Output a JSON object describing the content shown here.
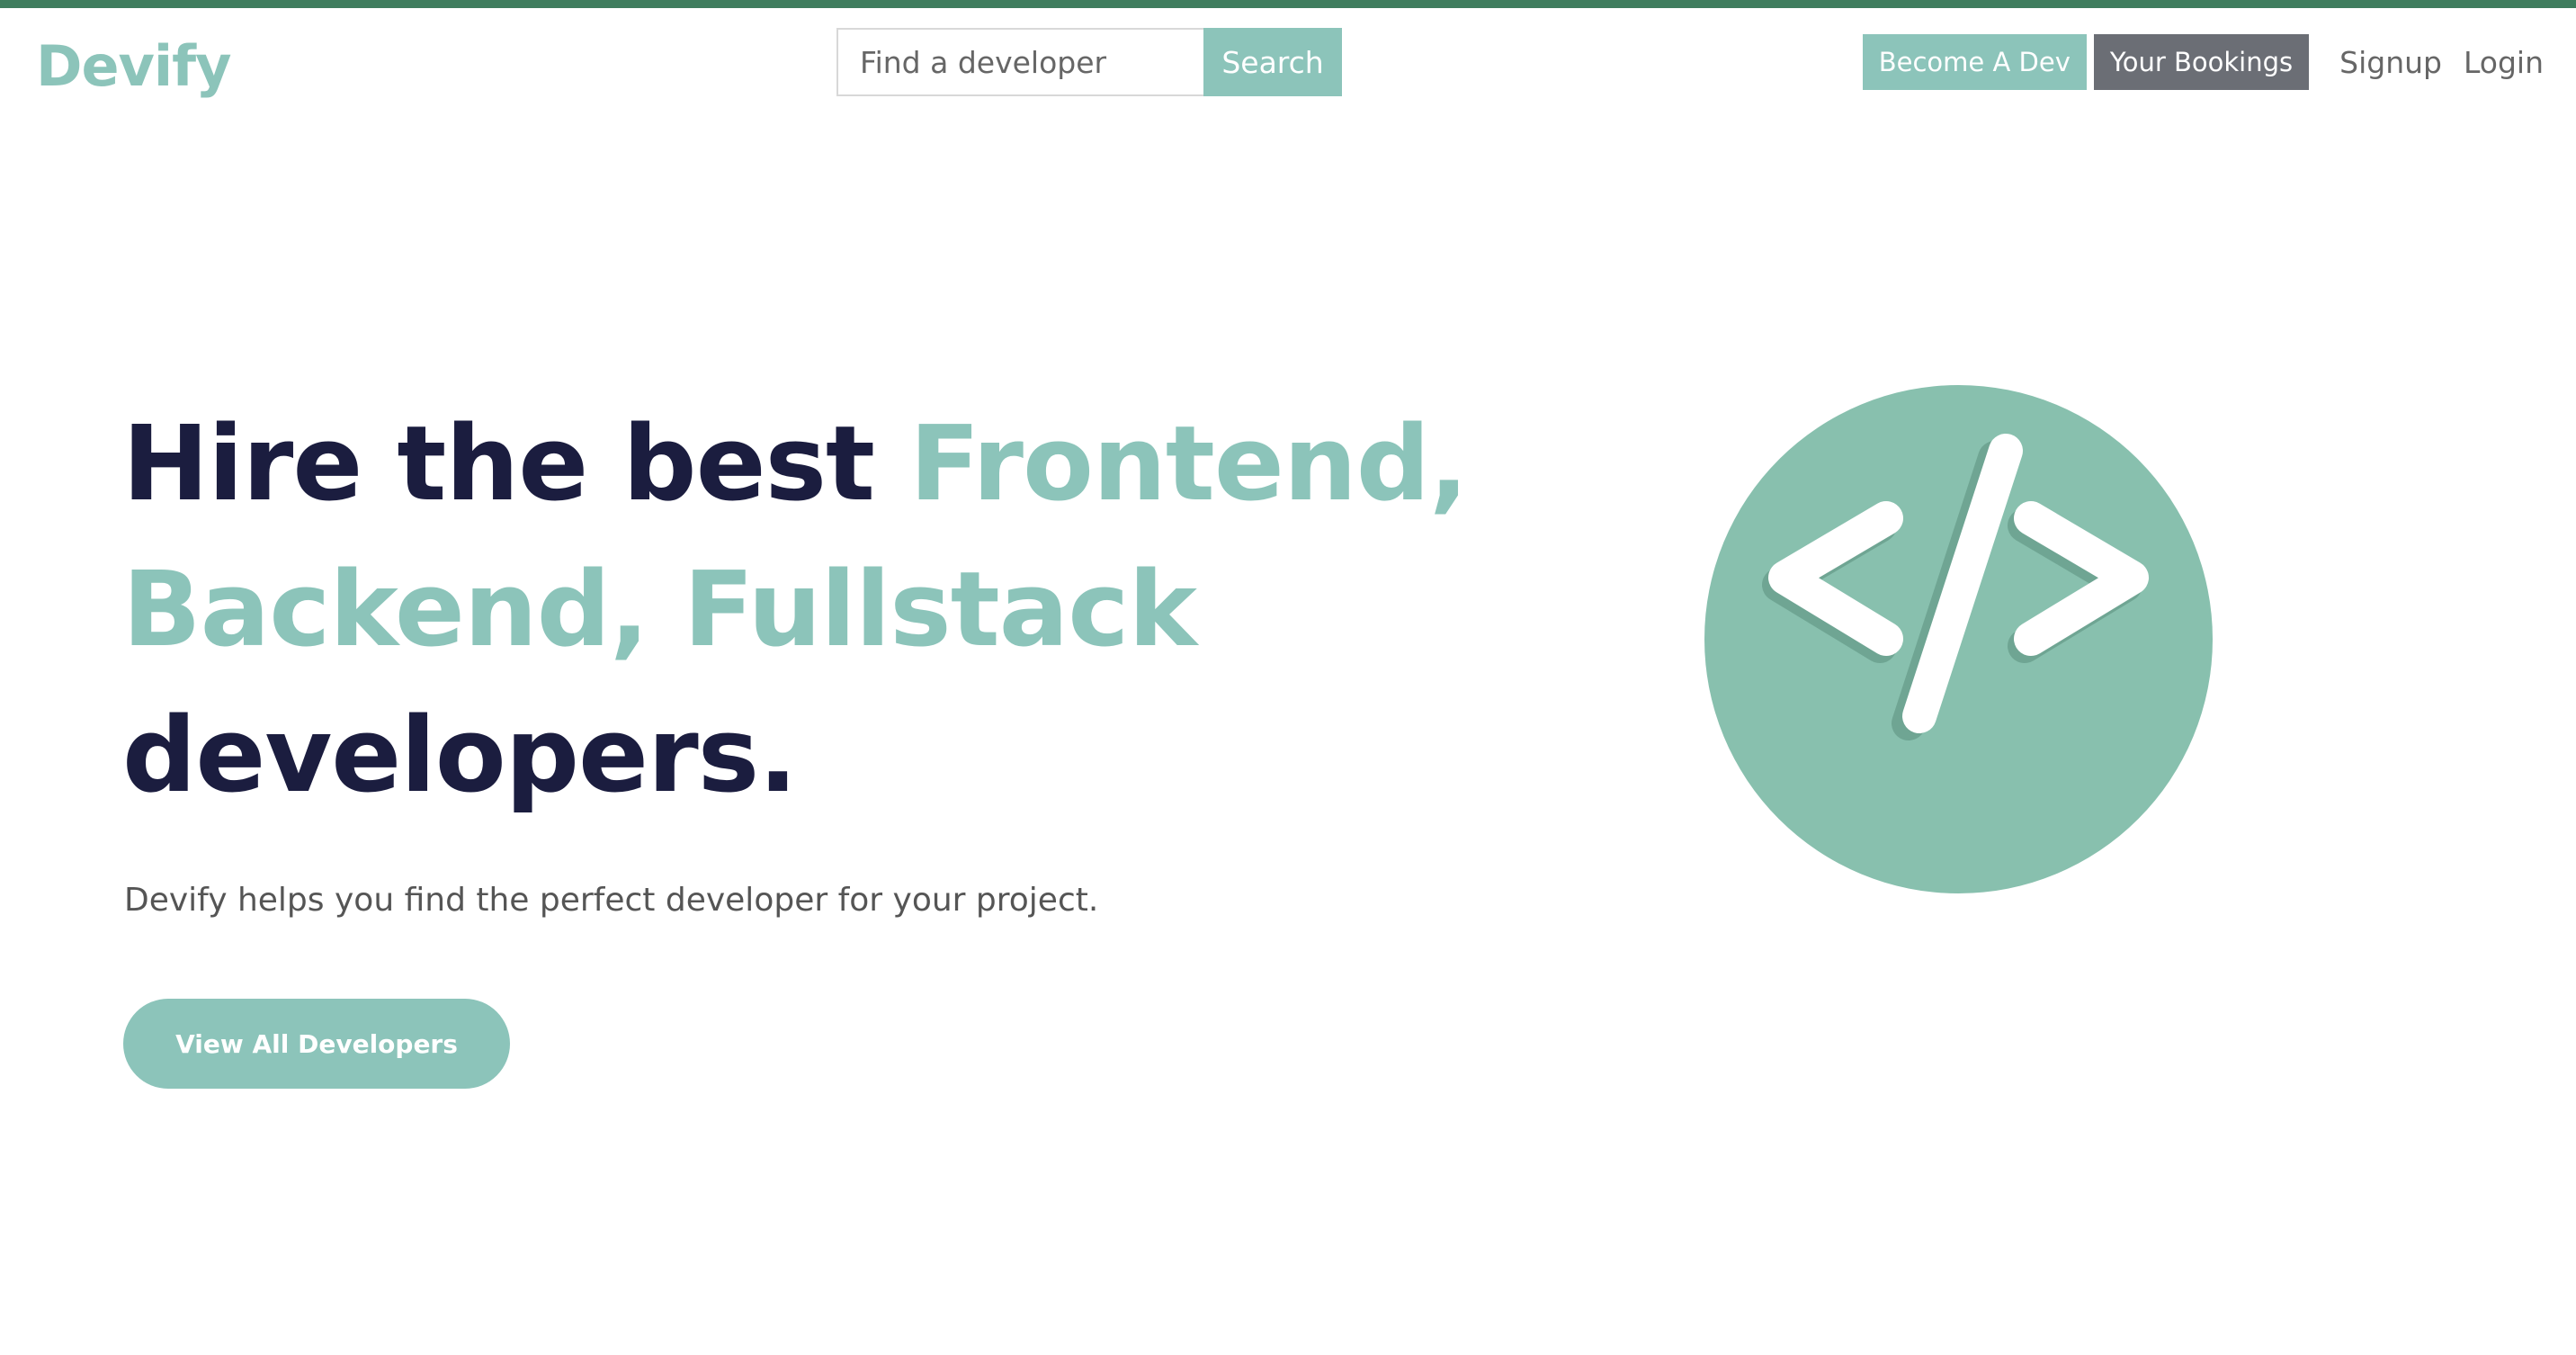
{
  "brand": {
    "name": "Devify",
    "accent_color": "#8cc4ba",
    "dark_color": "#1b1d3f",
    "top_bar_color": "#3f7d5e"
  },
  "search": {
    "placeholder": "Find a developer",
    "value": "",
    "button_label": "Search"
  },
  "nav": {
    "become_dev_label": "Become A Dev",
    "bookings_label": "Your Bookings",
    "signup_label": "Signup",
    "login_label": "Login",
    "bookings_color": "#6b6e75"
  },
  "hero": {
    "heading_part1": "Hire the best ",
    "heading_accent": "Frontend, Backend, Fullstack",
    "heading_part2": " developers.",
    "subtitle": "Devify helps you find the perfect developer for your project.",
    "cta_label": "View All Developers",
    "illustration_icon": "code-icon"
  }
}
